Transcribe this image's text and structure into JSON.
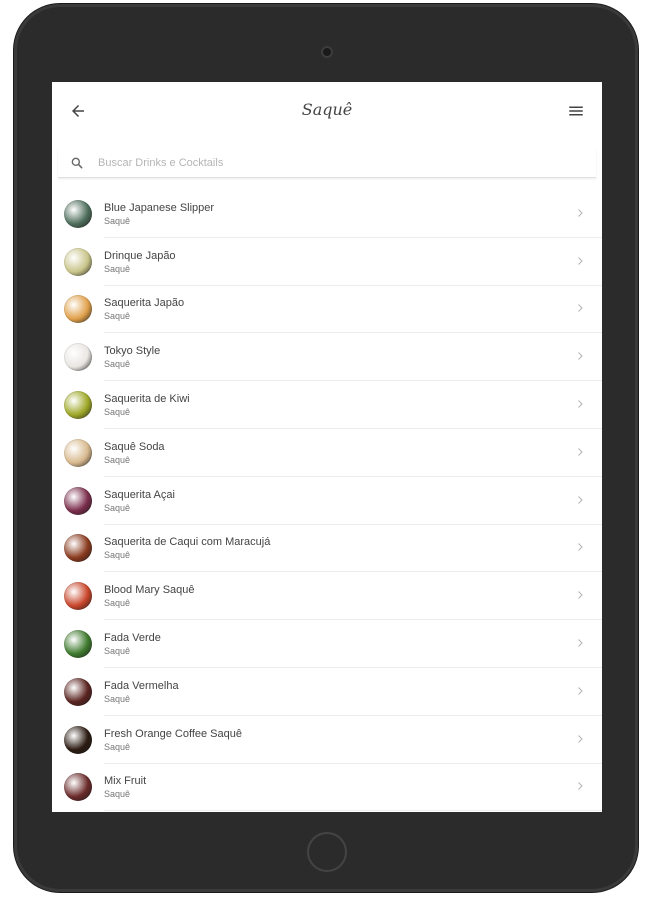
{
  "header": {
    "title": "Saquê",
    "back_icon": "arrow-left-icon",
    "menu_icon": "hamburger-menu-icon"
  },
  "search": {
    "placeholder": "Buscar Drinks e Cocktails",
    "value": ""
  },
  "drinks": [
    {
      "name": "Blue Japanese Slipper",
      "category": "Saquê",
      "color": "#4f6e5c"
    },
    {
      "name": "Drinque Japão",
      "category": "Saquê",
      "color": "#c9c58a"
    },
    {
      "name": "Saquerita Japão",
      "category": "Saquê",
      "color": "#e0a04a"
    },
    {
      "name": "Tokyo Style",
      "category": "Saquê",
      "color": "#e9e6e2"
    },
    {
      "name": "Saquerita de Kiwi",
      "category": "Saquê",
      "color": "#9ea827"
    },
    {
      "name": "Saquê Soda",
      "category": "Saquê",
      "color": "#d8b98e"
    },
    {
      "name": "Saquerita Açai",
      "category": "Saquê",
      "color": "#7a2d4a"
    },
    {
      "name": "Saquerita de Caqui com Maracujá",
      "category": "Saquê",
      "color": "#8a3a1e"
    },
    {
      "name": "Blood Mary Saquê",
      "category": "Saquê",
      "color": "#c8452a"
    },
    {
      "name": "Fada Verde",
      "category": "Saquê",
      "color": "#3e7a2e"
    },
    {
      "name": "Fada Vermelha",
      "category": "Saquê",
      "color": "#5a2420"
    },
    {
      "name": "Fresh Orange Coffee Saquê",
      "category": "Saquê",
      "color": "#2b1b12"
    },
    {
      "name": "Mix Fruit",
      "category": "Saquê",
      "color": "#6a2a2a"
    }
  ]
}
